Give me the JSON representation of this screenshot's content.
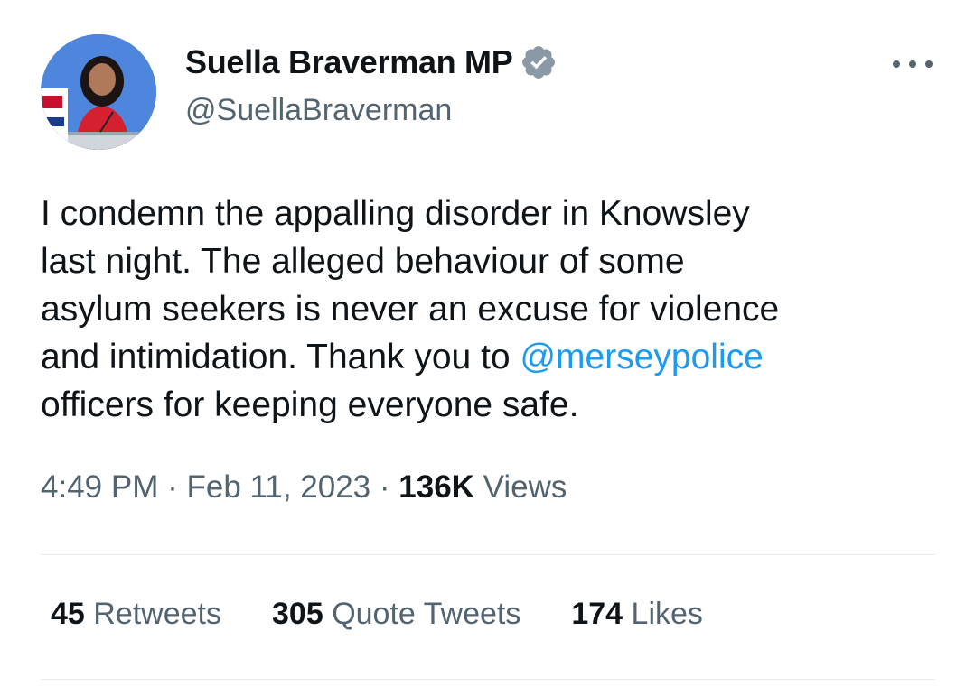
{
  "author": {
    "display_name": "Suella Braverman MP",
    "handle": "@SuellaBraverman",
    "verified_icon": "verified-badge-icon",
    "verified_color": "#8b98a5"
  },
  "tweet": {
    "lines": [
      {
        "text": "I condemn the appalling disorder in Knowsley"
      },
      {
        "text": "last night. The alleged behaviour of some"
      },
      {
        "text": "asylum seekers is never an excuse for violence"
      },
      {
        "pre": "and intimidation. Thank you to ",
        "mention": "@merseypolice"
      },
      {
        "text": "officers for keeping everyone safe."
      }
    ],
    "mention_color": "#1d9bf0"
  },
  "meta": {
    "time": "4:49 PM",
    "sep1": " · ",
    "date": "Feb 11, 2023",
    "sep2": " · ",
    "views_count": "136K",
    "views_label": " Views"
  },
  "stats": {
    "retweets_count": "45",
    "retweets_label": " Retweets",
    "quotes_count": "305",
    "quotes_label": " Quote Tweets",
    "likes_count": "174",
    "likes_label": " Likes"
  },
  "more_icon": "more-options-icon"
}
